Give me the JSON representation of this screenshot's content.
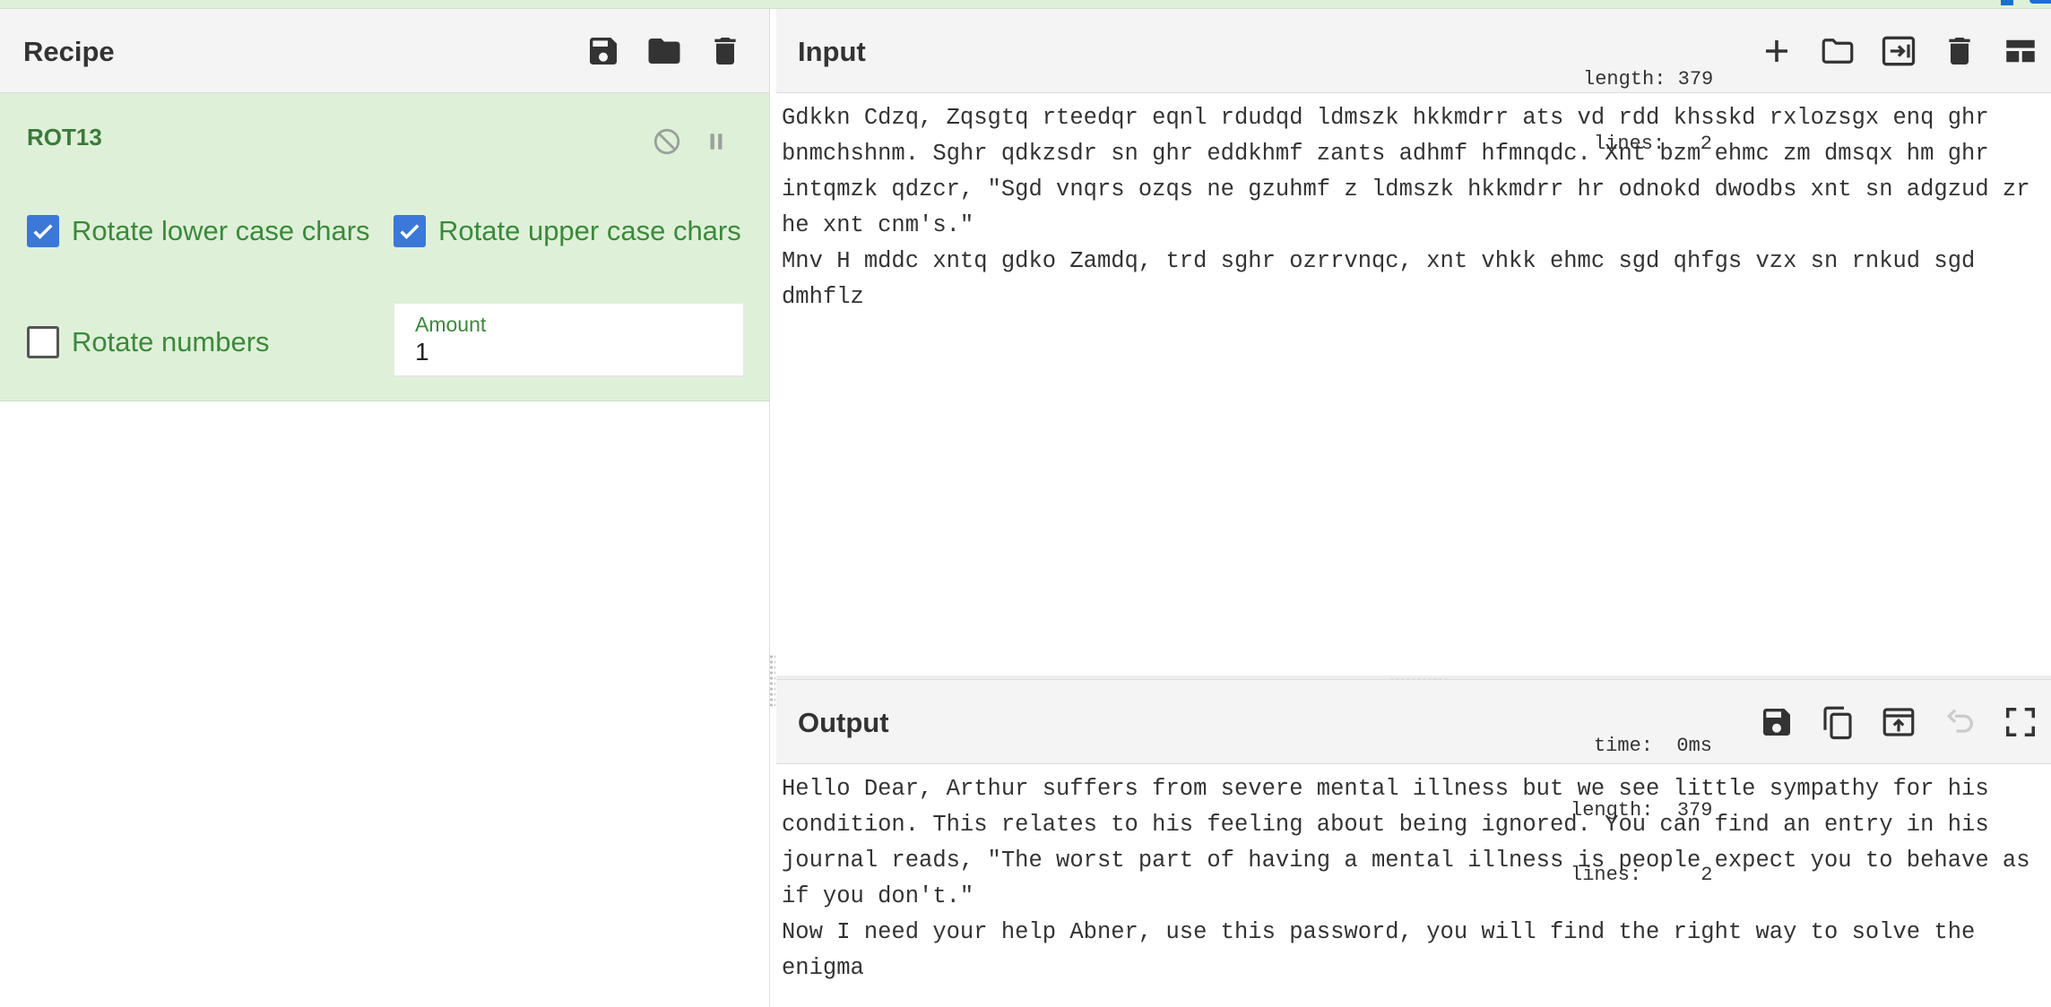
{
  "recipe": {
    "title": "Recipe",
    "icons": [
      "save-icon",
      "folder-icon",
      "trash-icon"
    ],
    "operation": {
      "name": "ROT13",
      "icons": [
        "disable-icon",
        "pause-icon"
      ],
      "options": {
        "rotate_lower": {
          "label": "Rotate lower case chars",
          "checked": true
        },
        "rotate_upper": {
          "label": "Rotate upper case chars",
          "checked": true
        },
        "rotate_numbers": {
          "label": "Rotate numbers",
          "checked": false
        },
        "amount": {
          "label": "Amount",
          "value": "1"
        }
      }
    }
  },
  "input": {
    "title": "Input",
    "stats": {
      "length_label": "length:",
      "length_value": "379",
      "lines_label": "lines:",
      "lines_value": "2"
    },
    "icons": [
      "plus-icon",
      "folder-icon",
      "input-into-icon",
      "trash-icon",
      "layout-icon"
    ],
    "text": "Gdkkn Cdzq, Zqsgtq rteedqr eqnl rdudqd ldmszk hkkmdrr ats vd rdd khsskd rxlozsgx enq ghr bnmchshnm. Sghr qdkzsdr sn ghr eddkhmf zants adhmf hfmnqdc. Xnt bzm ehmc zm dmsqx hm ghr intqmzk qdzcr, \"Sgd vnqrs ozqs ne gzuhmf z ldmszk hkkmdrr hr odnokd dwodbs xnt sn adgzud zr he xnt cnm's.\"\nMnv H mddc xntq gdko Zamdq, trd sghr ozrrvnqc, xnt vhkk ehmc sgd qhfgs vzx sn rnkud sgd dmhflz"
  },
  "output": {
    "title": "Output",
    "stats": {
      "time_label": "time:",
      "time_value": "0ms",
      "length_label": "length:",
      "length_value": "379",
      "lines_label": "lines:",
      "lines_value": "2"
    },
    "icons": [
      "save-icon",
      "copy-icon",
      "replace-input-icon",
      "undo-icon",
      "maximize-icon"
    ],
    "text": "Hello Dear, Arthur suffers from severe mental illness but we see little sympathy for his condition. This relates to his feeling about being ignored. You can find an entry in his journal reads, \"The worst part of having a mental illness is people expect you to behave as if you don't.\"\nNow I need your help Abner, use this password, you will find the right way to solve the enigma"
  },
  "colors": {
    "accent_green": "#3a8a3a",
    "op_background": "#dff0d8",
    "checkbox_blue": "#3b78d8"
  }
}
